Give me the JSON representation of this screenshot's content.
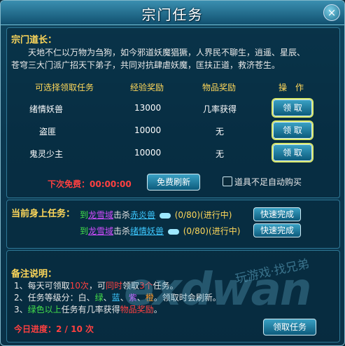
{
  "window": {
    "title": "宗门任务",
    "close": "×"
  },
  "leader": {
    "heading": "宗门道长：",
    "line1": "天地不仁以万物为刍狗，如今邪道妖魔猖獗，人界民不聊生，逍遥、星辰、",
    "line2": "苍穹三大门派广招天下弟子，共同对抗肆虐妖魔，匡扶正道，救济苍生。"
  },
  "table": {
    "headers": [
      "可选择领取任务",
      "经验奖励",
      "物品奖励",
      "操　作"
    ],
    "rows": [
      {
        "task": "绪情妖兽",
        "exp": "13000",
        "item": "几率获得",
        "action": "领 取"
      },
      {
        "task": "盗匪",
        "exp": "10000",
        "item": "无",
        "action": "领 取"
      },
      {
        "task": "鬼灵少主",
        "exp": "10000",
        "item": "无",
        "action": "领 取"
      }
    ]
  },
  "refresh": {
    "free_label": "下次免费：00:00:00",
    "button": "免费刷新",
    "auto_buy": "道具不足自动购买"
  },
  "current": {
    "heading": "当前身上任务：",
    "tasks": [
      {
        "pre": "到",
        "place": "龙雪域",
        "verb": "击杀",
        "target": "赤炎兽",
        "progress": "(0/80)(进行中)",
        "button": "快速完成"
      },
      {
        "pre": "到",
        "place": "龙雪域",
        "verb": "击杀",
        "target": "绪情妖兽",
        "progress": "(0/80)(进行中)",
        "button": "快速完成"
      }
    ]
  },
  "notes": {
    "heading": "备注说明：",
    "l1_a": "1、每天可领取",
    "l1_b": "10次",
    "l1_c": "，可",
    "l1_d": "同时",
    "l1_e": "领取",
    "l1_f": "3个",
    "l1_g": "任务。",
    "l2_a": "2、任务等级分：白、",
    "l2_b": "绿",
    "l2_c": "、",
    "l2_d": "蓝",
    "l2_e": "、",
    "l2_f": "紫",
    "l2_g": "、",
    "l2_h": "橙",
    "l2_i": "。领取时会刷新。",
    "l3_a": "3、",
    "l3_b": "绿色以上",
    "l3_c": "任务有几率获得",
    "l3_d": "物品奖励",
    "l3_e": "。"
  },
  "footer": {
    "progress": "今日进度：2 / 10 次",
    "button": "领取任务"
  },
  "watermark": {
    "text": "玩游戏·找兄弟",
    "brand": "exdwan"
  }
}
